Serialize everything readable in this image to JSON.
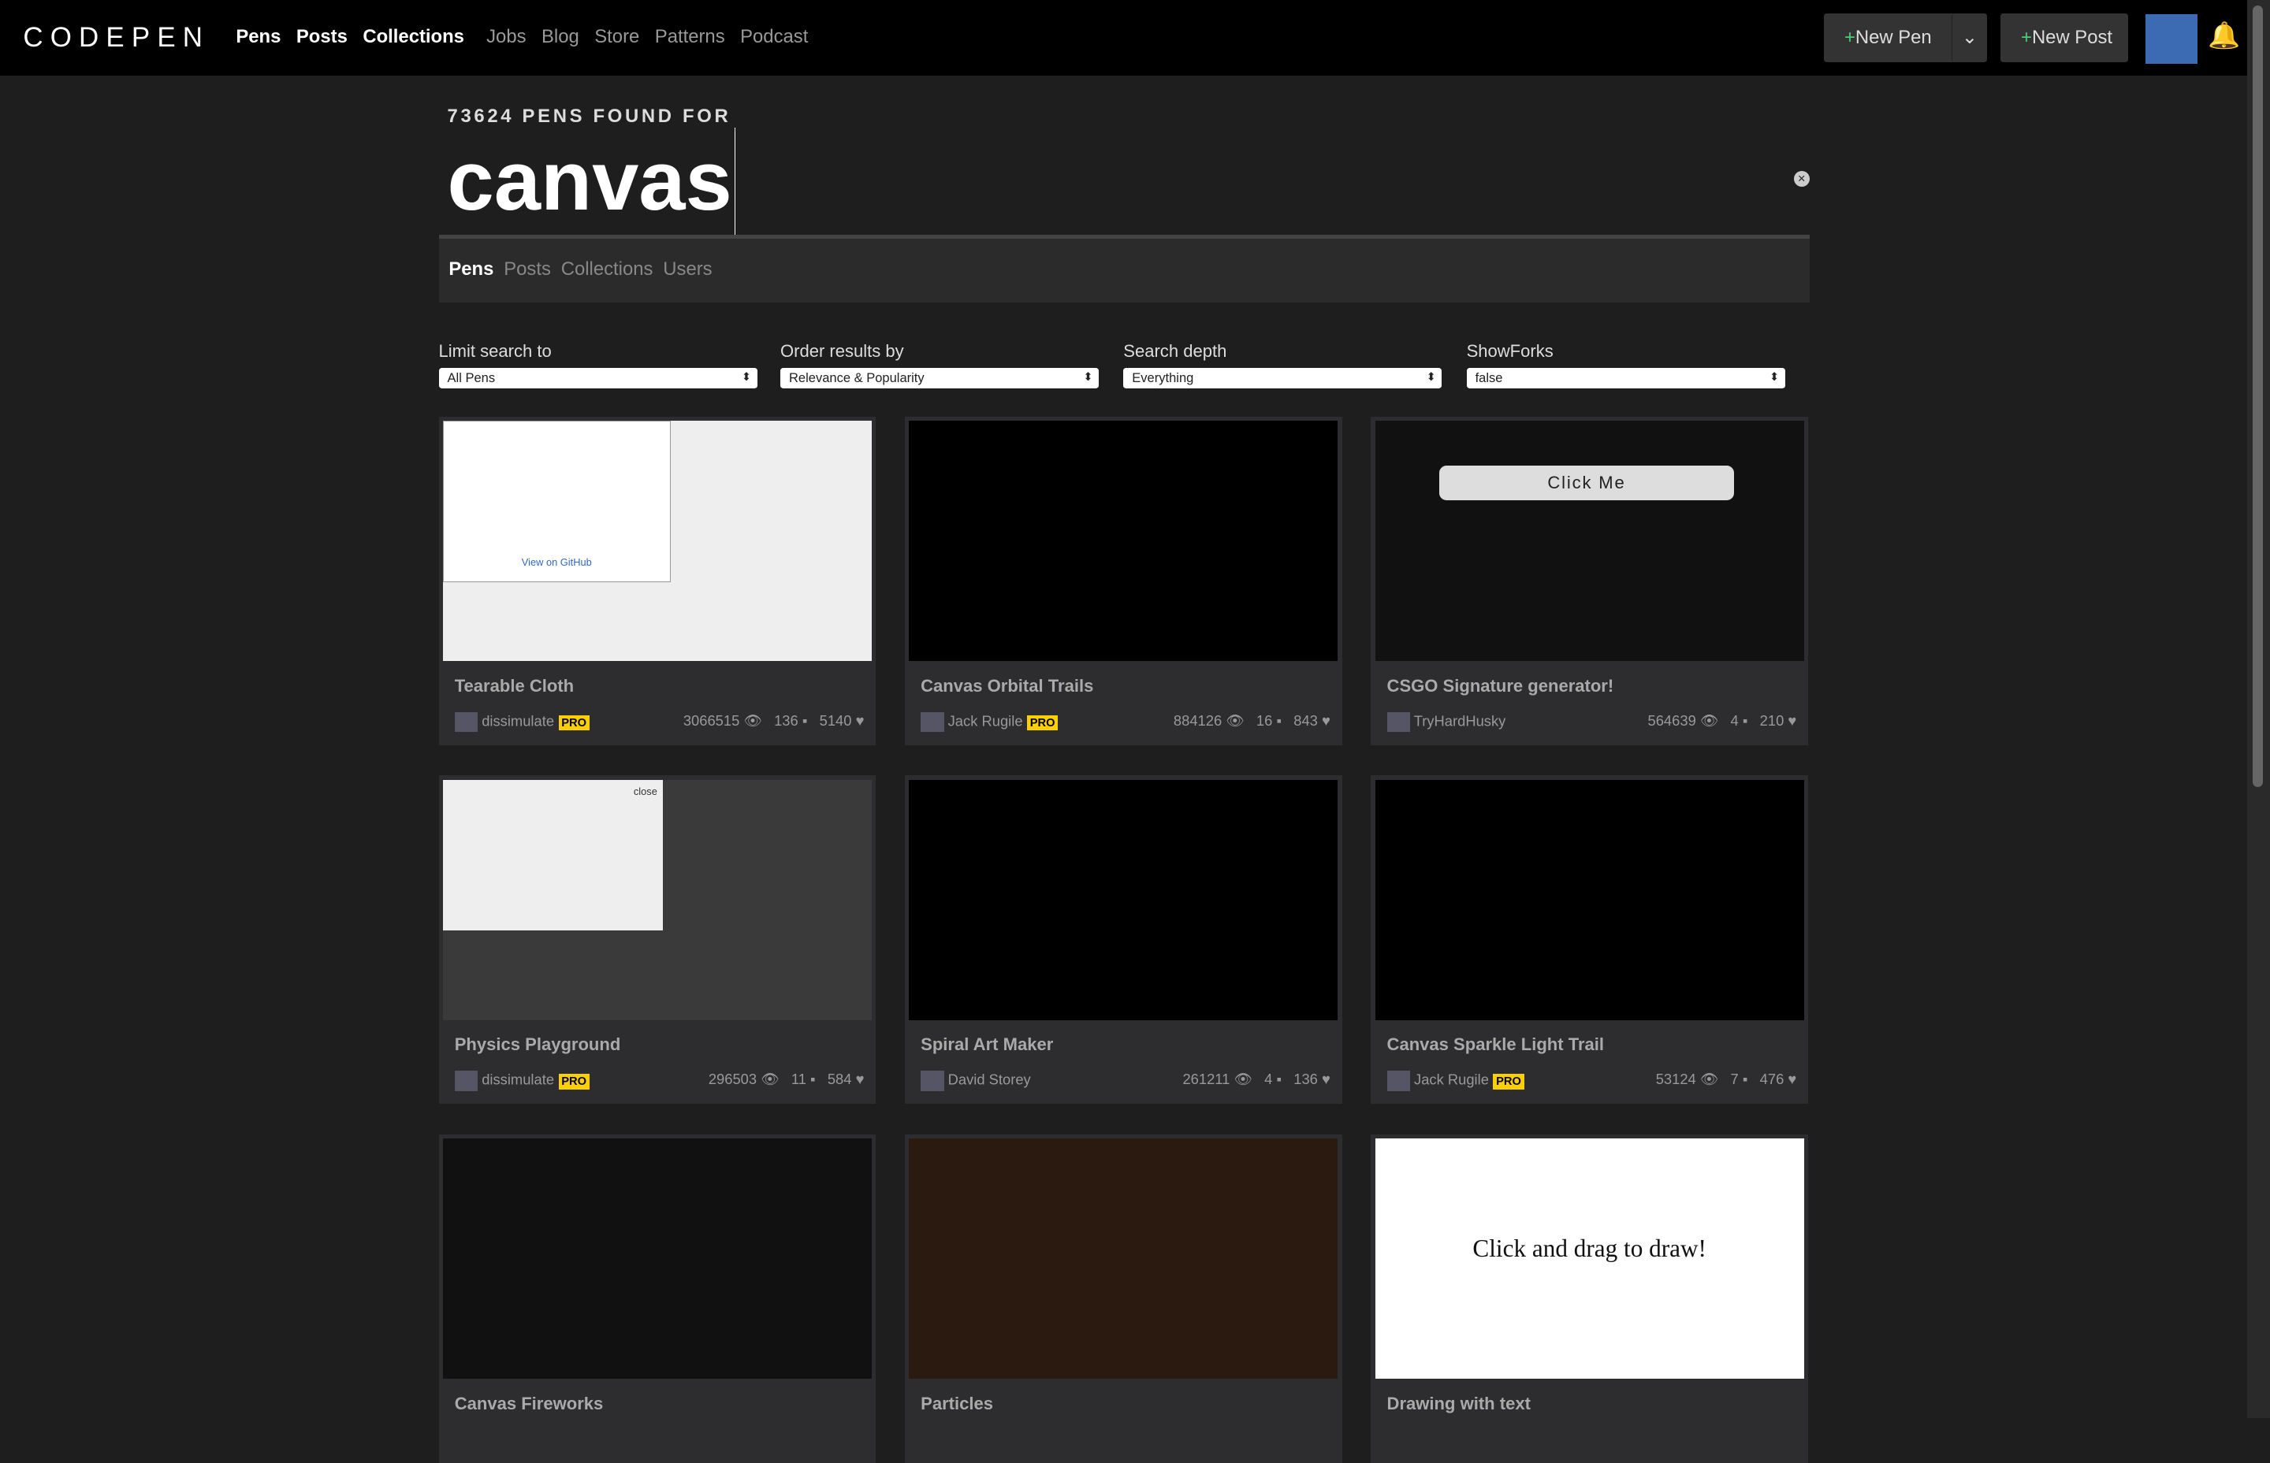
{
  "header": {
    "logo": "CODEPEN",
    "main_nav": [
      "Pens",
      "Posts",
      "Collections"
    ],
    "secondary_nav": [
      "Jobs",
      "Blog",
      "Store",
      "Patterns",
      "Podcast"
    ],
    "new_pen": "New Pen",
    "new_post": "New Post"
  },
  "search": {
    "count_text": "73624 PENS FOUND FOR",
    "query": "canvas",
    "tabs": [
      "Pens",
      "Posts",
      "Collections",
      "Users"
    ],
    "active_tab": "Pens"
  },
  "filters": [
    {
      "label": "Limit search to",
      "value": "All Pens"
    },
    {
      "label": "Order results by",
      "value": "Relevance & Popularity"
    },
    {
      "label": "Search depth",
      "value": "Everything"
    },
    {
      "label": "ShowForks",
      "value": "false"
    }
  ],
  "pens": [
    {
      "title": "Tearable Cloth",
      "author": "dissimulate",
      "pro": true,
      "views": "3066515",
      "comments": "136",
      "likes": "5140",
      "preview_text": "View on GitHub"
    },
    {
      "title": "Canvas Orbital Trails",
      "author": "Jack Rugile",
      "pro": true,
      "views": "884126",
      "comments": "16",
      "likes": "843"
    },
    {
      "title": "CSGO Signature generator!",
      "author": "TryHardHusky",
      "pro": false,
      "views": "564639",
      "comments": "4",
      "likes": "210",
      "preview_text": "Click Me"
    },
    {
      "title": "Physics Playground",
      "author": "dissimulate",
      "pro": true,
      "views": "296503",
      "comments": "11",
      "likes": "584",
      "preview_text": "close"
    },
    {
      "title": "Spiral Art Maker",
      "author": "David Storey",
      "pro": false,
      "views": "261211",
      "comments": "4",
      "likes": "136"
    },
    {
      "title": "Canvas Sparkle Light Trail",
      "author": "Jack Rugile",
      "pro": true,
      "views": "53124",
      "comments": "7",
      "likes": "476"
    },
    {
      "title": "Canvas Fireworks"
    },
    {
      "title": "Particles"
    },
    {
      "title": "Drawing with text",
      "preview_text": "Click and drag to draw!"
    }
  ],
  "pro_label": "PRO"
}
